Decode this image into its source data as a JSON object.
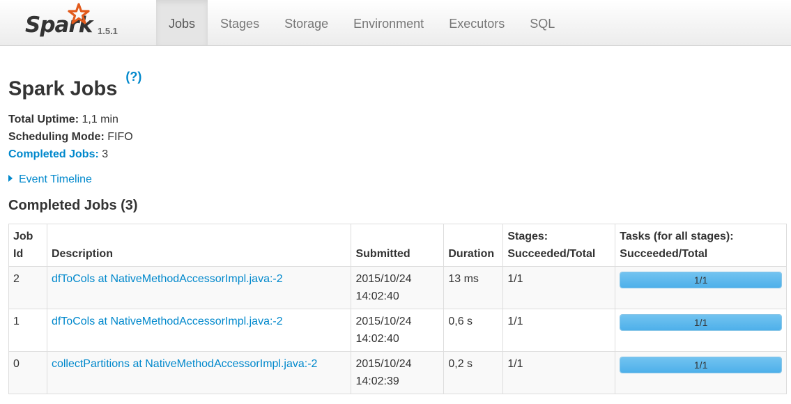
{
  "brand": {
    "logo_text": "Spark",
    "version": "1.5.1"
  },
  "nav": {
    "tabs": [
      {
        "label": "Jobs",
        "active": true
      },
      {
        "label": "Stages",
        "active": false
      },
      {
        "label": "Storage",
        "active": false
      },
      {
        "label": "Environment",
        "active": false
      },
      {
        "label": "Executors",
        "active": false
      },
      {
        "label": "SQL",
        "active": false
      }
    ]
  },
  "page": {
    "title": "Spark Jobs",
    "help_link": "(?)"
  },
  "summary": {
    "uptime_label": "Total Uptime:",
    "uptime_value": "1,1 min",
    "mode_label": "Scheduling Mode:",
    "mode_value": "FIFO",
    "completed_label": "Completed Jobs:",
    "completed_value": "3"
  },
  "event_timeline": {
    "label": "Event Timeline"
  },
  "completed_section": {
    "title": "Completed Jobs (3)"
  },
  "table": {
    "headers": {
      "job_id_1": "Job",
      "job_id_2": "Id",
      "description": "Description",
      "submitted": "Submitted",
      "duration": "Duration",
      "stages_1": "Stages:",
      "stages_2": "Succeeded/Total",
      "tasks_1": "Tasks (for all stages):",
      "tasks_2": "Succeeded/Total"
    },
    "rows": [
      {
        "job_id": "2",
        "description": "dfToCols at NativeMethodAccessorImpl.java:-2",
        "submitted_date": "2015/10/24",
        "submitted_time": "14:02:40",
        "duration": "13 ms",
        "stages": "1/1",
        "tasks": "1/1",
        "tasks_fraction": 1.0
      },
      {
        "job_id": "1",
        "description": "dfToCols at NativeMethodAccessorImpl.java:-2",
        "submitted_date": "2015/10/24",
        "submitted_time": "14:02:40",
        "duration": "0,6 s",
        "stages": "1/1",
        "tasks": "1/1",
        "tasks_fraction": 1.0
      },
      {
        "job_id": "0",
        "description": "collectPartitions at NativeMethodAccessorImpl.java:-2",
        "submitted_date": "2015/10/24",
        "submitted_time": "14:02:39",
        "duration": "0,2 s",
        "stages": "1/1",
        "tasks": "1/1",
        "tasks_fraction": 1.0
      }
    ]
  },
  "colors": {
    "link": "#0088cc",
    "progress": "#5ab8ee",
    "logo_star": "#e25a1c"
  }
}
